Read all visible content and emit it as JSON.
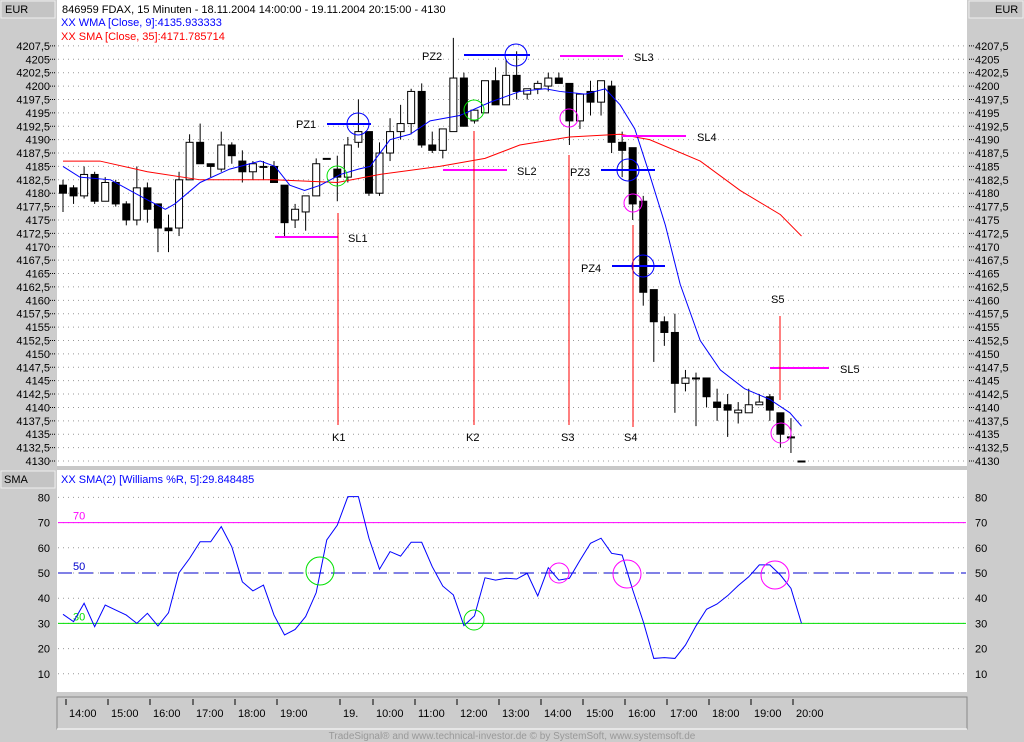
{
  "header": {
    "title": "846959  FDAX, 15 Minuten - 18.11.2004 14:00:00 - 19.11.2004 20:15:00 - 4130",
    "wma_label": "XX WMA [Close, 9]:4135.933333",
    "sma_label": "XX SMA [Close, 35]:4171.785714",
    "currency_left": "EUR",
    "currency_right": "EUR"
  },
  "lower_panel": {
    "name_left": "SMA",
    "indicator_label": "XX SMA(2) [Williams %R, 5]:29.848485",
    "level_70": "70",
    "level_50": "50",
    "level_30": "30"
  },
  "footer": "TradeSignal® and www.technical-investor.de © by SystemSoft, www.systemsoft.de",
  "colors": {
    "wma": "#0000ff",
    "sma": "#ff0000",
    "signal": "#ff00ff",
    "positive": "#00e000",
    "marker": "#ff0000"
  },
  "annotations": {
    "PZ1": "PZ1",
    "PZ2": "PZ2",
    "PZ3": "PZ3",
    "PZ4": "PZ4",
    "SL1": "SL1",
    "SL2": "SL2",
    "SL3": "SL3",
    "SL4": "SL4",
    "SL5": "SL5",
    "K1": "K1",
    "K2": "K2",
    "S3": "S3",
    "S4": "S4",
    "S5": "S5"
  },
  "chart_data": [
    {
      "type": "candlestick",
      "title": "846959 FDAX, 15 Minuten",
      "ylabel": "EUR",
      "ylim": [
        4130,
        4207.5
      ],
      "y_ticks": [
        "4130",
        "4132,5",
        "4135",
        "4137,5",
        "4140",
        "4142,5",
        "4145",
        "4147,5",
        "4150",
        "4152,5",
        "4155",
        "4157,5",
        "4160",
        "4162,5",
        "4165",
        "4167,5",
        "4170",
        "4172,5",
        "4175",
        "4177,5",
        "4180",
        "4182,5",
        "4185",
        "4187,5",
        "4190",
        "4192,5",
        "4195",
        "4197,5",
        "4200",
        "4202,5",
        "4205",
        "4207,5"
      ],
      "x_ticks": [
        "14:00",
        "15:00",
        "16:00",
        "17:00",
        "18:00",
        "19:00",
        "19.",
        "10:00",
        "11:00",
        "12:00",
        "13:00",
        "14:00",
        "15:00",
        "16:00",
        "17:00",
        "18:00",
        "19:00",
        "20:00"
      ],
      "grid": true,
      "ohlc": [
        [
          4181.5,
          4182.5,
          4176.5,
          4180
        ],
        [
          4181,
          4181.5,
          4178,
          4179.5
        ],
        [
          4179.5,
          4185,
          4179,
          4183.5
        ],
        [
          4183.5,
          4184,
          4178,
          4178.5
        ],
        [
          4178.5,
          4183,
          4178.5,
          4182
        ],
        [
          4182,
          4182.5,
          4177.5,
          4178
        ],
        [
          4178,
          4178.5,
          4174,
          4175
        ],
        [
          4175,
          4185,
          4174,
          4181
        ],
        [
          4181,
          4182,
          4174.5,
          4177
        ],
        [
          4178,
          4178,
          4169,
          4173.5
        ],
        [
          4173.5,
          4176,
          4169,
          4173
        ],
        [
          4173.5,
          4184,
          4172,
          4182.5
        ],
        [
          4182.5,
          4191,
          4182.5,
          4189.5
        ],
        [
          4189.5,
          4193,
          4185.5,
          4185.5
        ],
        [
          4185.5,
          4185.5,
          4183,
          4185
        ],
        [
          4184.5,
          4191.5,
          4184,
          4189
        ],
        [
          4189,
          4189.5,
          4185.5,
          4187
        ],
        [
          4186,
          4188,
          4182,
          4184
        ],
        [
          4184,
          4186,
          4182.5,
          4185.5
        ],
        [
          4185,
          4186,
          4182.5,
          4185
        ],
        [
          4185,
          4186,
          4182,
          4182
        ],
        [
          4181.5,
          4181.5,
          4172,
          4174.5
        ],
        [
          4175,
          4178,
          4173.5,
          4177
        ],
        [
          4176.5,
          4179.5,
          4173,
          4179.5
        ],
        [
          4179.5,
          4186.5,
          4179.5,
          4185.5
        ],
        [
          4186.5,
          4186.5,
          4186.5,
          4186.5
        ],
        [
          4184.5,
          4187,
          4178.5,
          4183
        ],
        [
          4183,
          4190.5,
          4182,
          4189
        ],
        [
          4189.5,
          4197.5,
          4188.5,
          4191.5
        ],
        [
          4191.5,
          4191.5,
          4179.5,
          4180
        ],
        [
          4180,
          4189.5,
          4179.5,
          4187.5
        ],
        [
          4187.5,
          4194,
          4186,
          4191.5
        ],
        [
          4191.5,
          4196.5,
          4190,
          4193
        ],
        [
          4193,
          4199.5,
          4191,
          4199
        ],
        [
          4199,
          4200.5,
          4188.5,
          4189
        ],
        [
          4189,
          4191.5,
          4187.5,
          4188
        ],
        [
          4188,
          4192,
          4186.5,
          4192
        ],
        [
          4191.5,
          4209,
          4191.5,
          4201.5
        ],
        [
          4201.5,
          4202.5,
          4192.5,
          4192.5
        ],
        [
          4193.5,
          4195.5,
          4193,
          4195.5
        ],
        [
          4195,
          4201,
          4195,
          4201
        ],
        [
          4201,
          4203.5,
          4196.5,
          4196.5
        ],
        [
          4196.5,
          4205,
          4196.5,
          4202
        ],
        [
          4202,
          4206.5,
          4197.5,
          4199
        ],
        [
          4198.5,
          4199.5,
          4197.5,
          4199.5
        ],
        [
          4199.5,
          4201,
          4198.5,
          4200.5
        ],
        [
          4200,
          4202.5,
          4199,
          4201.5
        ],
        [
          4201.5,
          4202.5,
          4200.5,
          4200.5
        ],
        [
          4200.5,
          4200.5,
          4189,
          4193.5
        ],
        [
          4193.5,
          4198.5,
          4192,
          4198.5
        ],
        [
          4199,
          4201,
          4194.5,
          4197
        ],
        [
          4197,
          4201,
          4194.5,
          4201
        ],
        [
          4200,
          4201,
          4187.5,
          4189.5
        ],
        [
          4189.5,
          4191.5,
          4183,
          4188
        ],
        [
          4188.5,
          4188.5,
          4175,
          4178
        ],
        [
          4178.5,
          4179.5,
          4159,
          4161.5
        ],
        [
          4162,
          4162,
          4148.5,
          4156
        ],
        [
          4156,
          4157,
          4151.5,
          4154
        ],
        [
          4154,
          4157.5,
          4139,
          4144.5
        ],
        [
          4144.5,
          4147,
          4143,
          4145.5
        ],
        [
          4145.5,
          4146.5,
          4136.5,
          4145.5
        ],
        [
          4145.5,
          4145.5,
          4140,
          4142
        ],
        [
          4141,
          4143.5,
          4137.5,
          4140
        ],
        [
          4140.5,
          4142.5,
          4134.5,
          4139.5
        ],
        [
          4139,
          4141,
          4137,
          4139.5
        ],
        [
          4139,
          4143.5,
          4139,
          4140.5
        ],
        [
          4140.5,
          4142.5,
          4140.5,
          4141
        ],
        [
          4142,
          4142.5,
          4137.5,
          4139.5
        ],
        [
          4139,
          4139,
          4132.5,
          4135
        ],
        [
          4134.5,
          4138,
          4131.5,
          4134.5
        ],
        [
          4130,
          4130,
          4130,
          4130
        ]
      ],
      "series": [
        {
          "name": "WMA [Close, 9]",
          "points": [
            [
              0,
              4185
            ],
            [
              1.6,
              4183
            ],
            [
              4.5,
              4182.5
            ],
            [
              7.3,
              4179.5
            ],
            [
              9.7,
              4177
            ],
            [
              10.6,
              4178
            ],
            [
              13,
              4182
            ],
            [
              15.8,
              4184.5
            ],
            [
              18.7,
              4186
            ],
            [
              20.1,
              4185
            ],
            [
              21.5,
              4181.5
            ],
            [
              22.9,
              4180.5
            ],
            [
              24.4,
              4181.5
            ],
            [
              26.3,
              4183.5
            ],
            [
              28,
              4184.5
            ],
            [
              29.1,
              4185
            ],
            [
              31,
              4190
            ],
            [
              32.9,
              4191
            ],
            [
              34.8,
              4193.5
            ],
            [
              37.6,
              4194.5
            ],
            [
              40.5,
              4197
            ],
            [
              43.3,
              4199
            ],
            [
              45.7,
              4199.5
            ],
            [
              47.1,
              4199
            ],
            [
              49.5,
              4198.5
            ],
            [
              51.4,
              4199.5
            ],
            [
              52.8,
              4196.5
            ],
            [
              54.2,
              4192
            ],
            [
              55.6,
              4183.5
            ],
            [
              57.1,
              4174
            ],
            [
              58.5,
              4163
            ],
            [
              60.4,
              4152.5
            ],
            [
              62.3,
              4147
            ],
            [
              64.6,
              4143.5
            ],
            [
              67,
              4141.5
            ],
            [
              68.9,
              4139
            ],
            [
              70,
              4136.5
            ]
          ]
        },
        {
          "name": "SMA [Close, 35]",
          "points": [
            [
              0,
              4186
            ],
            [
              3.5,
              4186
            ],
            [
              8,
              4184
            ],
            [
              13,
              4182.5
            ],
            [
              20,
              4182.5
            ],
            [
              26,
              4182
            ],
            [
              30,
              4183.5
            ],
            [
              35.7,
              4185
            ],
            [
              40,
              4186.5
            ],
            [
              43.3,
              4189
            ],
            [
              48,
              4190.5
            ],
            [
              52.8,
              4191
            ],
            [
              55.6,
              4190
            ],
            [
              60.4,
              4186
            ],
            [
              64.2,
              4180.5
            ],
            [
              68,
              4176
            ],
            [
              70,
              4172
            ]
          ]
        }
      ]
    },
    {
      "type": "line",
      "title": "SMA(2) [Williams %R, 5]",
      "ylim": [
        5,
        85
      ],
      "y_ticks": [
        "10",
        "20",
        "30",
        "40",
        "50",
        "60",
        "70",
        "80"
      ],
      "reference_lines": [
        70,
        50,
        30
      ],
      "series": [
        {
          "name": "SMA(2) Williams %R",
          "values": [
            33.6,
            30.7,
            38,
            28.7,
            37.3,
            35.3,
            33.3,
            30,
            34,
            29,
            34.2,
            50.1,
            55.8,
            62.4,
            62.4,
            68.4,
            60.4,
            46.5,
            42.9,
            45.2,
            33.3,
            25.4,
            27.6,
            32.7,
            42.2,
            63.1,
            69,
            80.3,
            80.3,
            63.8,
            51.5,
            58.5,
            56.7,
            62.2,
            62.2,
            52.5,
            44.8,
            41.3,
            29.1,
            33,
            48.1,
            47.2,
            47.9,
            47.6,
            49.9,
            40.9,
            52.1,
            47.2,
            47.9,
            55,
            61.8,
            63.8,
            57.8,
            57.1,
            43.3,
            30.7,
            16.1,
            16.4,
            16.1,
            21.4,
            29,
            35.6,
            37.7,
            41,
            45,
            48.5,
            53.2,
            53.2,
            49.2,
            43.9,
            30
          ]
        }
      ]
    }
  ]
}
